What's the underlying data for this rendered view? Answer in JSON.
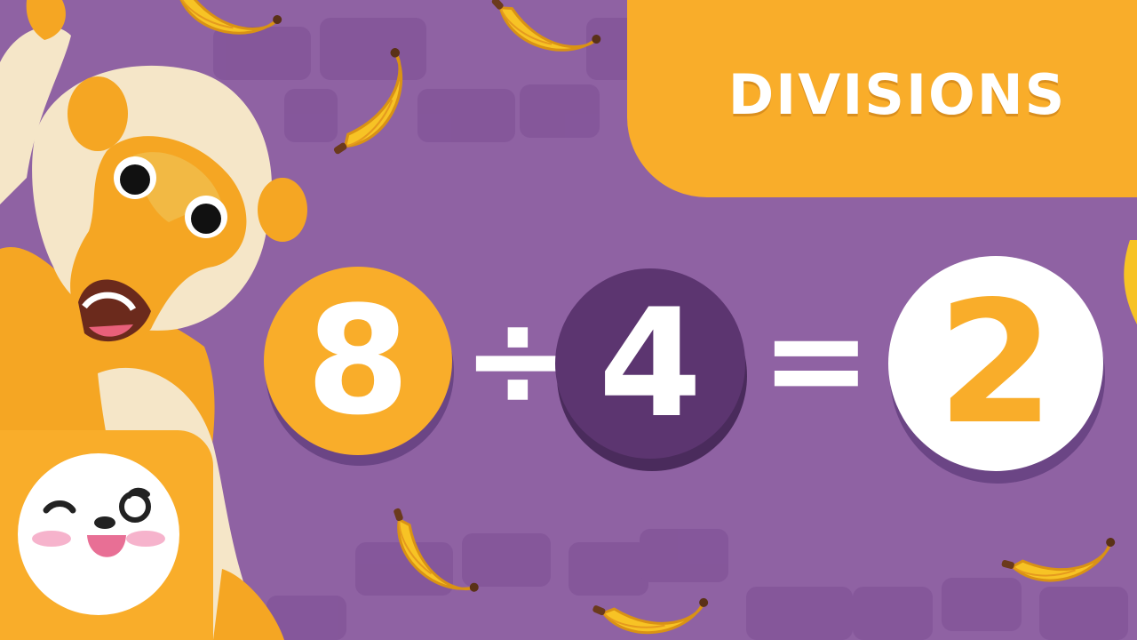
{
  "title": "DIVISIONS",
  "equation": {
    "dividend": "8",
    "divide_symbol": "÷",
    "divisor": "4",
    "equals_symbol": "=",
    "result": "2"
  },
  "colors": {
    "background": "#8f62a3",
    "accent_orange": "#f9ad2a",
    "dark_purple": "#5c3570",
    "white": "#ffffff"
  },
  "icons": [
    "monkey-illustration",
    "banana-icon",
    "smiling-face-logo"
  ]
}
